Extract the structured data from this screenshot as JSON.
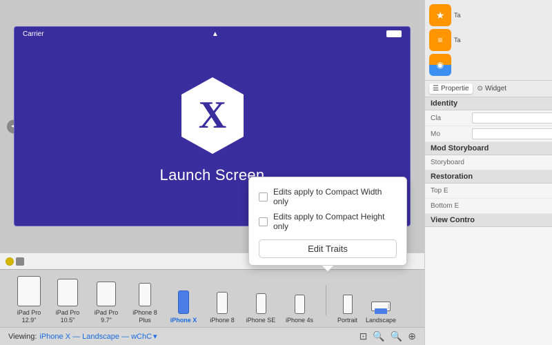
{
  "canvas": {
    "status_carrier": "Carrier",
    "launch_screen_label": "Launch Screen",
    "bottom_bar": {
      "icon1": "⊙",
      "icon2": "▫"
    }
  },
  "devices": [
    {
      "id": "ipad-pro-129",
      "label": "iPad Pro\n12.9\"",
      "type": "ipad-large",
      "selected": false
    },
    {
      "id": "ipad-pro-105",
      "label": "iPad Pro\n10.5\"",
      "type": "ipad-medium",
      "selected": false
    },
    {
      "id": "ipad-pro-97",
      "label": "iPad Pro\n9.7\"",
      "type": "ipad-small",
      "selected": false
    },
    {
      "id": "iphone-8-plus",
      "label": "iPhone 8\nPlus",
      "type": "iphone-large",
      "selected": false
    },
    {
      "id": "iphone-x",
      "label": "iPhone X",
      "type": "iphone-x",
      "selected": true
    },
    {
      "id": "iphone-8",
      "label": "iPhone 8",
      "type": "iphone-8",
      "selected": false
    },
    {
      "id": "iphone-se",
      "label": "iPhone SE",
      "type": "iphone-se",
      "selected": false
    },
    {
      "id": "iphone-4s",
      "label": "iPhone 4s",
      "type": "iphone-4s",
      "selected": false
    }
  ],
  "orientations": [
    {
      "id": "portrait",
      "label": "Portrait"
    },
    {
      "id": "landscape",
      "label": "Landscape"
    }
  ],
  "status_bar": {
    "viewing_label": "Viewing:",
    "viewing_device": "iPhone X — Landscape — wChC",
    "chevron": "▾"
  },
  "popup": {
    "checkbox1_label": "Edits apply to Compact Width only",
    "checkbox2_label": "Edits apply to Compact Height only",
    "edit_traits_label": "Edit Traits"
  },
  "right_panel": {
    "toolbar_icons": [
      {
        "id": "icon1",
        "symbol": "★",
        "color": "orange",
        "tab_label": "Ta"
      },
      {
        "id": "icon2",
        "symbol": "≡",
        "color": "orange",
        "tab_label": "Ta"
      },
      {
        "id": "icon3",
        "symbol": "◉",
        "color": "orange-blue",
        "tab_label": ""
      }
    ],
    "section_tabs": [
      {
        "id": "properties",
        "label": "Propertie",
        "active": true
      },
      {
        "id": "widget",
        "label": "Widget",
        "active": false
      }
    ],
    "identity_header": "Identity",
    "rows": [
      {
        "label": "Cla",
        "value": ""
      },
      {
        "label": "Mo",
        "value": ""
      },
      {
        "label": "Storyboard",
        "value": ""
      },
      {
        "label": "Restoration",
        "value": ""
      }
    ],
    "identity_label": "Identity",
    "mod_storyboard_label": "Mod Storyboard",
    "restoration_label": "Restoration",
    "top_label": "Top E",
    "bottom_label": "Bottom E",
    "view_control_label": "View Contro"
  }
}
